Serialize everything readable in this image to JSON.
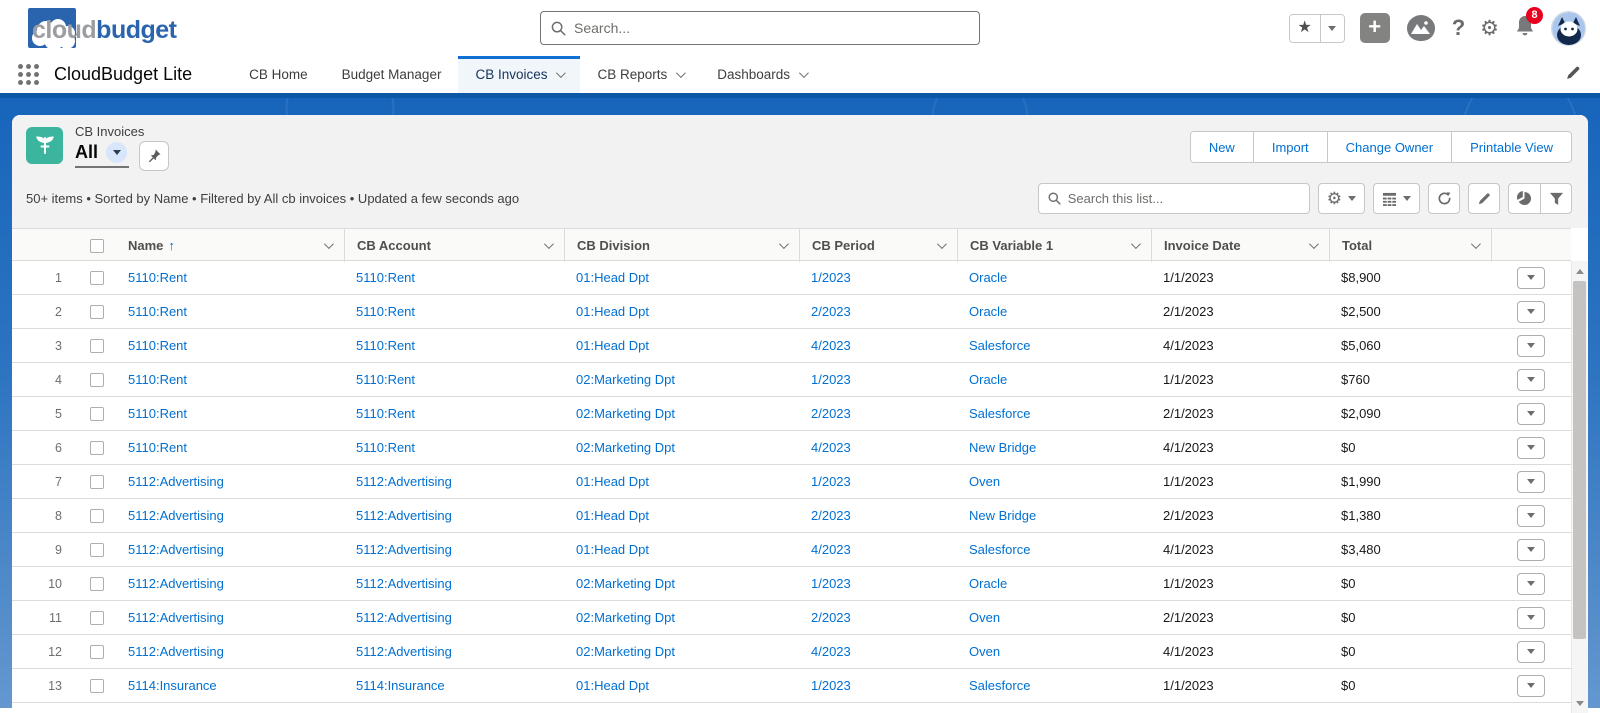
{
  "brand": {
    "word_part1": "cloud",
    "word_part2": "budget"
  },
  "header": {
    "search_placeholder": "Search...",
    "notification_count": "8",
    "icons": {
      "favorites": "star-glyph",
      "create": "+",
      "help": "?",
      "setup": "gear"
    }
  },
  "nav": {
    "app_name": "CloudBudget Lite",
    "tabs": [
      {
        "label": "CB Home",
        "has_menu": false,
        "active": false
      },
      {
        "label": "Budget Manager",
        "has_menu": false,
        "active": false
      },
      {
        "label": "CB Invoices",
        "has_menu": true,
        "active": true
      },
      {
        "label": "CB Reports",
        "has_menu": true,
        "active": false
      },
      {
        "label": "Dashboards",
        "has_menu": true,
        "active": false
      }
    ]
  },
  "list_header": {
    "entity": "CB Invoices",
    "view": "All",
    "status": "50+ items • Sorted by Name • Filtered by All cb invoices • Updated a few seconds ago",
    "actions": [
      "New",
      "Import",
      "Change Owner",
      "Printable View"
    ],
    "list_search_placeholder": "Search this list..."
  },
  "table": {
    "columns": [
      "Name",
      "CB Account",
      "CB Division",
      "CB Period",
      "CB Variable 1",
      "Invoice Date",
      "Total"
    ],
    "sorted_column": "Name",
    "sort_direction": "asc",
    "sort_glyph": "↑",
    "rows": [
      {
        "num": "1",
        "name": "5110:Rent",
        "account": "5110:Rent",
        "division": "01:Head Dpt",
        "period": "1/2023",
        "variable1": "Oracle",
        "invoice_date": "1/1/2023",
        "total": "$8,900"
      },
      {
        "num": "2",
        "name": "5110:Rent",
        "account": "5110:Rent",
        "division": "01:Head Dpt",
        "period": "2/2023",
        "variable1": "Oracle",
        "invoice_date": "2/1/2023",
        "total": "$2,500"
      },
      {
        "num": "3",
        "name": "5110:Rent",
        "account": "5110:Rent",
        "division": "01:Head Dpt",
        "period": "4/2023",
        "variable1": "Salesforce",
        "invoice_date": "4/1/2023",
        "total": "$5,060"
      },
      {
        "num": "4",
        "name": "5110:Rent",
        "account": "5110:Rent",
        "division": "02:Marketing Dpt",
        "period": "1/2023",
        "variable1": "Oracle",
        "invoice_date": "1/1/2023",
        "total": "$760"
      },
      {
        "num": "5",
        "name": "5110:Rent",
        "account": "5110:Rent",
        "division": "02:Marketing Dpt",
        "period": "2/2023",
        "variable1": "Salesforce",
        "invoice_date": "2/1/2023",
        "total": "$2,090"
      },
      {
        "num": "6",
        "name": "5110:Rent",
        "account": "5110:Rent",
        "division": "02:Marketing Dpt",
        "period": "4/2023",
        "variable1": "New Bridge",
        "invoice_date": "4/1/2023",
        "total": "$0"
      },
      {
        "num": "7",
        "name": "5112:Advertising",
        "account": "5112:Advertising",
        "division": "01:Head Dpt",
        "period": "1/2023",
        "variable1": "Oven",
        "invoice_date": "1/1/2023",
        "total": "$1,990"
      },
      {
        "num": "8",
        "name": "5112:Advertising",
        "account": "5112:Advertising",
        "division": "01:Head Dpt",
        "period": "2/2023",
        "variable1": "New Bridge",
        "invoice_date": "2/1/2023",
        "total": "$1,380"
      },
      {
        "num": "9",
        "name": "5112:Advertising",
        "account": "5112:Advertising",
        "division": "01:Head Dpt",
        "period": "4/2023",
        "variable1": "Salesforce",
        "invoice_date": "4/1/2023",
        "total": "$3,480"
      },
      {
        "num": "10",
        "name": "5112:Advertising",
        "account": "5112:Advertising",
        "division": "02:Marketing Dpt",
        "period": "1/2023",
        "variable1": "Oracle",
        "invoice_date": "1/1/2023",
        "total": "$0"
      },
      {
        "num": "11",
        "name": "5112:Advertising",
        "account": "5112:Advertising",
        "division": "02:Marketing Dpt",
        "period": "2/2023",
        "variable1": "Oven",
        "invoice_date": "2/1/2023",
        "total": "$0"
      },
      {
        "num": "12",
        "name": "5112:Advertising",
        "account": "5112:Advertising",
        "division": "02:Marketing Dpt",
        "period": "4/2023",
        "variable1": "Oven",
        "invoice_date": "4/1/2023",
        "total": "$0"
      },
      {
        "num": "13",
        "name": "5114:Insurance",
        "account": "5114:Insurance",
        "division": "01:Head Dpt",
        "period": "1/2023",
        "variable1": "Salesforce",
        "invoice_date": "1/1/2023",
        "total": "$0"
      }
    ]
  },
  "colors": {
    "link_blue": "#0070d2",
    "banner_blue": "#1765bb",
    "banner_edge_blue": "#0d58a6",
    "object_icon_teal": "#3bb59e",
    "badge_red": "#ea001e",
    "active_tab_bar": "#0f6fd2"
  }
}
